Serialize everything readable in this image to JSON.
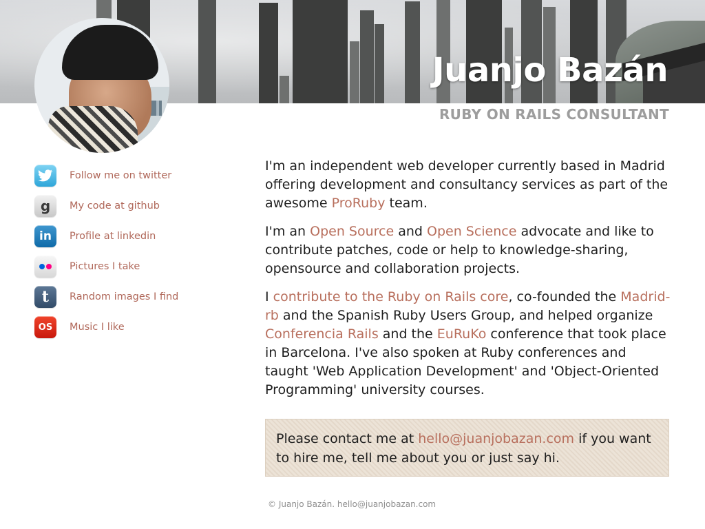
{
  "header": {
    "title": "Juanjo Bazán",
    "subtitle": "RUBY ON RAILS CONSULTANT"
  },
  "sidebar": {
    "items": [
      {
        "icon": "twitter-icon",
        "label": "Follow me on twitter"
      },
      {
        "icon": "github-icon",
        "label": "My code at github"
      },
      {
        "icon": "linkedin-icon",
        "label": "Profile at linkedin"
      },
      {
        "icon": "flickr-icon",
        "label": "Pictures I take"
      },
      {
        "icon": "tumblr-icon",
        "label": "Random images I find"
      },
      {
        "icon": "lastfm-icon",
        "label": "Music I like"
      }
    ]
  },
  "main": {
    "p1": {
      "before": "I'm an independent web developer currently based in Madrid offering development and consultancy services as part of the awesome ",
      "link": "ProRuby",
      "after": " team."
    },
    "p2": {
      "t1": "I'm an ",
      "link1": "Open Source",
      "t2": " and ",
      "link2": "Open Science",
      "t3": " advocate and like to contribute patches, code or help to knowledge-sharing, opensource and collaboration projects."
    },
    "p3": {
      "t1": "I ",
      "link1": "contribute to the Ruby on Rails core",
      "t2": ", co-founded the ",
      "link2": "Madrid-rb",
      "t3": " and the Spanish Ruby Users Group, and helped organize ",
      "link3": "Conferencia Rails",
      "t4": " and the ",
      "link4": "EuRuKo",
      "t5": " conference that took place in Barcelona. I've also spoken at Ruby conferences and taught 'Web Application Development' and 'Object-Oriented Programming' university courses."
    }
  },
  "contact": {
    "before": "Please contact me at ",
    "email": "hello@juanjobazan.com",
    "after": " if you want to hire me, tell me about you or just say hi."
  },
  "footer": {
    "text": "© Juanjo Bazán. hello@juanjobazan.com"
  },
  "colors": {
    "link": "#b86f5d",
    "sidebar_link": "#b0685a",
    "subtitle": "#9d9d9d",
    "contact_bg": "#ece3d7"
  }
}
